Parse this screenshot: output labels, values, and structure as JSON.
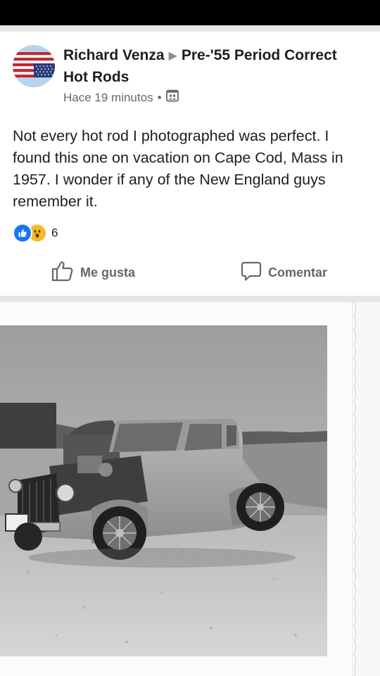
{
  "post": {
    "author": "Richard Venza",
    "group": "Pre-'55 Period Correct Hot Rods",
    "time": "Hace 19 minutos",
    "separator": "•",
    "privacy_icon": "group-privacy-icon",
    "text": "Not every hot rod I photographed was perfect. I found this one on vacation on Cape Cod, Mass in 1957. I wonder if any of the New England guys remember it.",
    "reactions": {
      "types": [
        "like",
        "wow"
      ],
      "count": "6"
    }
  },
  "actions": {
    "like_label": "Me gusta",
    "comment_label": "Comentar"
  },
  "colors": {
    "like_blue": "#1877f2",
    "wow_yellow": "#f7b928",
    "secondary_text": "#65676b",
    "separator": "#e4e6eb"
  }
}
